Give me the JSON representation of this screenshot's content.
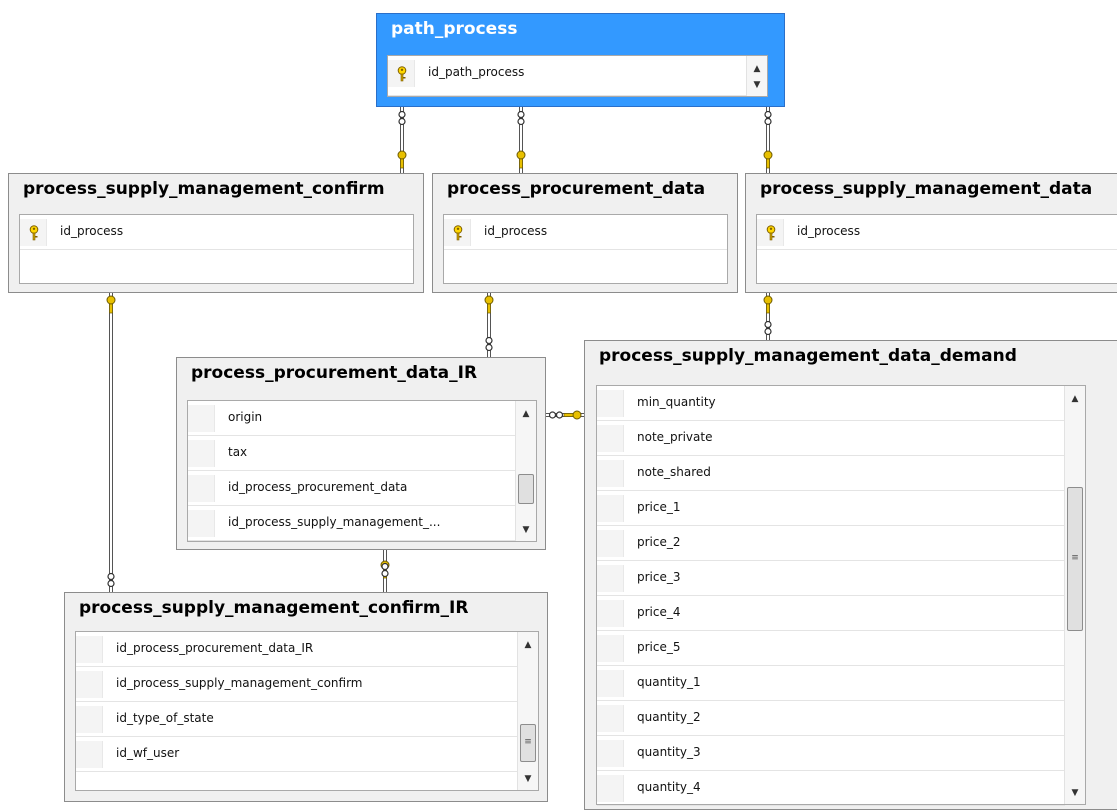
{
  "tables": [
    {
      "id": "path_process",
      "title": "path_process",
      "columns": [
        {
          "name": "id_path_process",
          "pk": true
        }
      ]
    },
    {
      "id": "psmc",
      "title": "process_supply_management_confirm",
      "columns": [
        {
          "name": "id_process",
          "pk": true
        }
      ]
    },
    {
      "id": "ppd",
      "title": "process_procurement_data",
      "columns": [
        {
          "name": "id_process",
          "pk": true
        }
      ]
    },
    {
      "id": "psmd",
      "title": "process_supply_management_data",
      "columns": [
        {
          "name": "id_process",
          "pk": true
        }
      ]
    },
    {
      "id": "ppdir",
      "title": "process_procurement_data_IR",
      "columns": [
        {
          "name": "origin",
          "pk": false
        },
        {
          "name": "tax",
          "pk": false
        },
        {
          "name": "id_process_procurement_data",
          "pk": false
        },
        {
          "name": "id_process_supply_management_...",
          "pk": false
        }
      ]
    },
    {
      "id": "psmcir",
      "title": "process_supply_management_confirm_IR",
      "columns": [
        {
          "name": "id_process_procurement_data_IR",
          "pk": false
        },
        {
          "name": "id_process_supply_management_confirm",
          "pk": false
        },
        {
          "name": "id_type_of_state",
          "pk": false
        },
        {
          "name": "id_wf_user",
          "pk": false
        }
      ]
    },
    {
      "id": "psmdd",
      "title": "process_supply_management_data_demand",
      "columns": [
        {
          "name": "min_quantity",
          "pk": false
        },
        {
          "name": "note_private",
          "pk": false
        },
        {
          "name": "note_shared",
          "pk": false
        },
        {
          "name": "price_1",
          "pk": false
        },
        {
          "name": "price_2",
          "pk": false
        },
        {
          "name": "price_3",
          "pk": false
        },
        {
          "name": "price_4",
          "pk": false
        },
        {
          "name": "price_5",
          "pk": false
        },
        {
          "name": "quantity_1",
          "pk": false
        },
        {
          "name": "quantity_2",
          "pk": false
        },
        {
          "name": "quantity_3",
          "pk": false
        },
        {
          "name": "quantity_4",
          "pk": false
        }
      ]
    }
  ],
  "relationships": [
    {
      "from": "path_process",
      "to": "psmc"
    },
    {
      "from": "path_process",
      "to": "ppd"
    },
    {
      "from": "path_process",
      "to": "psmd"
    },
    {
      "from": "psmc",
      "to": "psmcir"
    },
    {
      "from": "ppd",
      "to": "ppdir"
    },
    {
      "from": "ppdir",
      "to": "psmcir"
    },
    {
      "from": "psmdd",
      "to": "ppdir"
    },
    {
      "from": "psmd",
      "to": "psmdd"
    }
  ],
  "selected_table": "path_process",
  "colors": {
    "selection": "#3399ff",
    "key": "#e8c000",
    "panel": "#f0f0f0"
  }
}
